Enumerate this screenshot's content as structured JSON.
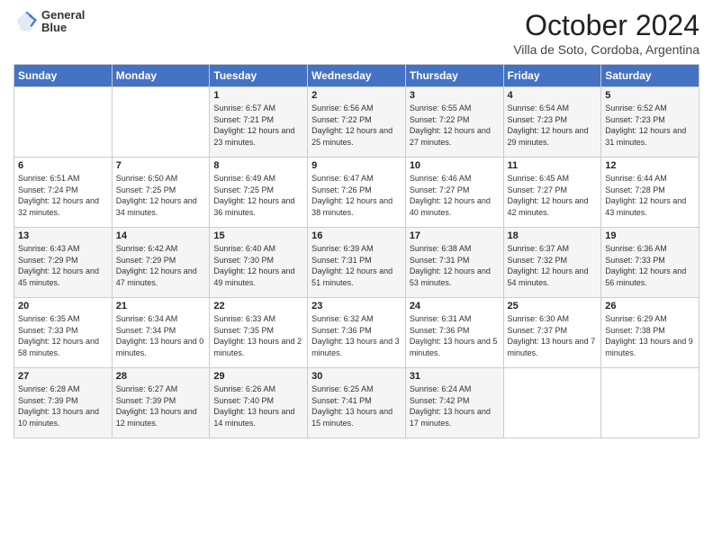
{
  "logo": {
    "line1": "General",
    "line2": "Blue"
  },
  "title": "October 2024",
  "location": "Villa de Soto, Cordoba, Argentina",
  "weekdays": [
    "Sunday",
    "Monday",
    "Tuesday",
    "Wednesday",
    "Thursday",
    "Friday",
    "Saturday"
  ],
  "weeks": [
    [
      null,
      null,
      {
        "day": "1",
        "sunrise": "Sunrise: 6:57 AM",
        "sunset": "Sunset: 7:21 PM",
        "daylight": "Daylight: 12 hours and 23 minutes."
      },
      {
        "day": "2",
        "sunrise": "Sunrise: 6:56 AM",
        "sunset": "Sunset: 7:22 PM",
        "daylight": "Daylight: 12 hours and 25 minutes."
      },
      {
        "day": "3",
        "sunrise": "Sunrise: 6:55 AM",
        "sunset": "Sunset: 7:22 PM",
        "daylight": "Daylight: 12 hours and 27 minutes."
      },
      {
        "day": "4",
        "sunrise": "Sunrise: 6:54 AM",
        "sunset": "Sunset: 7:23 PM",
        "daylight": "Daylight: 12 hours and 29 minutes."
      },
      {
        "day": "5",
        "sunrise": "Sunrise: 6:52 AM",
        "sunset": "Sunset: 7:23 PM",
        "daylight": "Daylight: 12 hours and 31 minutes."
      }
    ],
    [
      {
        "day": "6",
        "sunrise": "Sunrise: 6:51 AM",
        "sunset": "Sunset: 7:24 PM",
        "daylight": "Daylight: 12 hours and 32 minutes."
      },
      {
        "day": "7",
        "sunrise": "Sunrise: 6:50 AM",
        "sunset": "Sunset: 7:25 PM",
        "daylight": "Daylight: 12 hours and 34 minutes."
      },
      {
        "day": "8",
        "sunrise": "Sunrise: 6:49 AM",
        "sunset": "Sunset: 7:25 PM",
        "daylight": "Daylight: 12 hours and 36 minutes."
      },
      {
        "day": "9",
        "sunrise": "Sunrise: 6:47 AM",
        "sunset": "Sunset: 7:26 PM",
        "daylight": "Daylight: 12 hours and 38 minutes."
      },
      {
        "day": "10",
        "sunrise": "Sunrise: 6:46 AM",
        "sunset": "Sunset: 7:27 PM",
        "daylight": "Daylight: 12 hours and 40 minutes."
      },
      {
        "day": "11",
        "sunrise": "Sunrise: 6:45 AM",
        "sunset": "Sunset: 7:27 PM",
        "daylight": "Daylight: 12 hours and 42 minutes."
      },
      {
        "day": "12",
        "sunrise": "Sunrise: 6:44 AM",
        "sunset": "Sunset: 7:28 PM",
        "daylight": "Daylight: 12 hours and 43 minutes."
      }
    ],
    [
      {
        "day": "13",
        "sunrise": "Sunrise: 6:43 AM",
        "sunset": "Sunset: 7:29 PM",
        "daylight": "Daylight: 12 hours and 45 minutes."
      },
      {
        "day": "14",
        "sunrise": "Sunrise: 6:42 AM",
        "sunset": "Sunset: 7:29 PM",
        "daylight": "Daylight: 12 hours and 47 minutes."
      },
      {
        "day": "15",
        "sunrise": "Sunrise: 6:40 AM",
        "sunset": "Sunset: 7:30 PM",
        "daylight": "Daylight: 12 hours and 49 minutes."
      },
      {
        "day": "16",
        "sunrise": "Sunrise: 6:39 AM",
        "sunset": "Sunset: 7:31 PM",
        "daylight": "Daylight: 12 hours and 51 minutes."
      },
      {
        "day": "17",
        "sunrise": "Sunrise: 6:38 AM",
        "sunset": "Sunset: 7:31 PM",
        "daylight": "Daylight: 12 hours and 53 minutes."
      },
      {
        "day": "18",
        "sunrise": "Sunrise: 6:37 AM",
        "sunset": "Sunset: 7:32 PM",
        "daylight": "Daylight: 12 hours and 54 minutes."
      },
      {
        "day": "19",
        "sunrise": "Sunrise: 6:36 AM",
        "sunset": "Sunset: 7:33 PM",
        "daylight": "Daylight: 12 hours and 56 minutes."
      }
    ],
    [
      {
        "day": "20",
        "sunrise": "Sunrise: 6:35 AM",
        "sunset": "Sunset: 7:33 PM",
        "daylight": "Daylight: 12 hours and 58 minutes."
      },
      {
        "day": "21",
        "sunrise": "Sunrise: 6:34 AM",
        "sunset": "Sunset: 7:34 PM",
        "daylight": "Daylight: 13 hours and 0 minutes."
      },
      {
        "day": "22",
        "sunrise": "Sunrise: 6:33 AM",
        "sunset": "Sunset: 7:35 PM",
        "daylight": "Daylight: 13 hours and 2 minutes."
      },
      {
        "day": "23",
        "sunrise": "Sunrise: 6:32 AM",
        "sunset": "Sunset: 7:36 PM",
        "daylight": "Daylight: 13 hours and 3 minutes."
      },
      {
        "day": "24",
        "sunrise": "Sunrise: 6:31 AM",
        "sunset": "Sunset: 7:36 PM",
        "daylight": "Daylight: 13 hours and 5 minutes."
      },
      {
        "day": "25",
        "sunrise": "Sunrise: 6:30 AM",
        "sunset": "Sunset: 7:37 PM",
        "daylight": "Daylight: 13 hours and 7 minutes."
      },
      {
        "day": "26",
        "sunrise": "Sunrise: 6:29 AM",
        "sunset": "Sunset: 7:38 PM",
        "daylight": "Daylight: 13 hours and 9 minutes."
      }
    ],
    [
      {
        "day": "27",
        "sunrise": "Sunrise: 6:28 AM",
        "sunset": "Sunset: 7:39 PM",
        "daylight": "Daylight: 13 hours and 10 minutes."
      },
      {
        "day": "28",
        "sunrise": "Sunrise: 6:27 AM",
        "sunset": "Sunset: 7:39 PM",
        "daylight": "Daylight: 13 hours and 12 minutes."
      },
      {
        "day": "29",
        "sunrise": "Sunrise: 6:26 AM",
        "sunset": "Sunset: 7:40 PM",
        "daylight": "Daylight: 13 hours and 14 minutes."
      },
      {
        "day": "30",
        "sunrise": "Sunrise: 6:25 AM",
        "sunset": "Sunset: 7:41 PM",
        "daylight": "Daylight: 13 hours and 15 minutes."
      },
      {
        "day": "31",
        "sunrise": "Sunrise: 6:24 AM",
        "sunset": "Sunset: 7:42 PM",
        "daylight": "Daylight: 13 hours and 17 minutes."
      },
      null,
      null
    ]
  ]
}
